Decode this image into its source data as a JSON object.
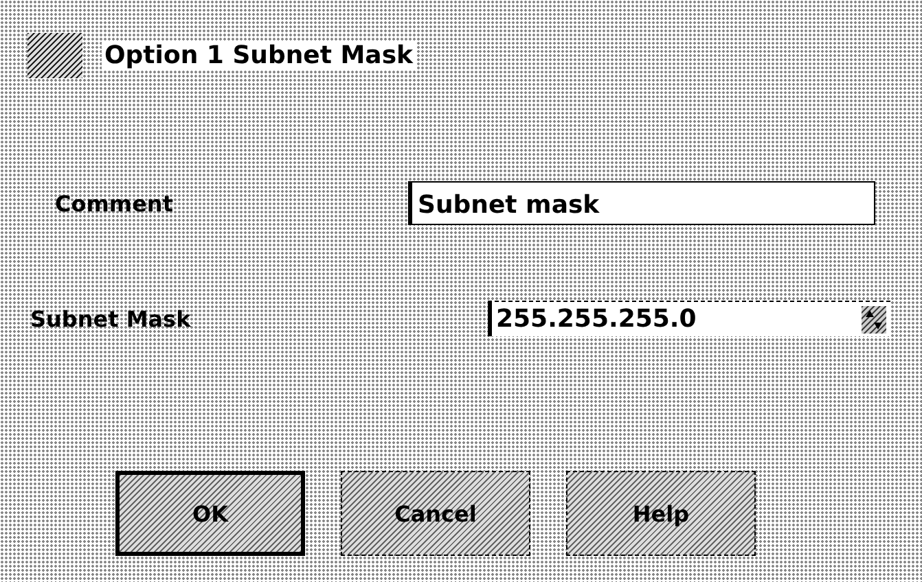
{
  "window": {
    "title": "Option 1 Subnet Mask"
  },
  "fields": [
    {
      "kind": "text",
      "label": "Comment",
      "value": "Subnet mask"
    },
    {
      "kind": "spin",
      "label": "Subnet Mask",
      "value": "255.255.255.0"
    }
  ],
  "buttons": [
    {
      "label": "OK",
      "default": true
    },
    {
      "label": "Cancel",
      "default": false
    },
    {
      "label": "Help",
      "default": false
    }
  ]
}
